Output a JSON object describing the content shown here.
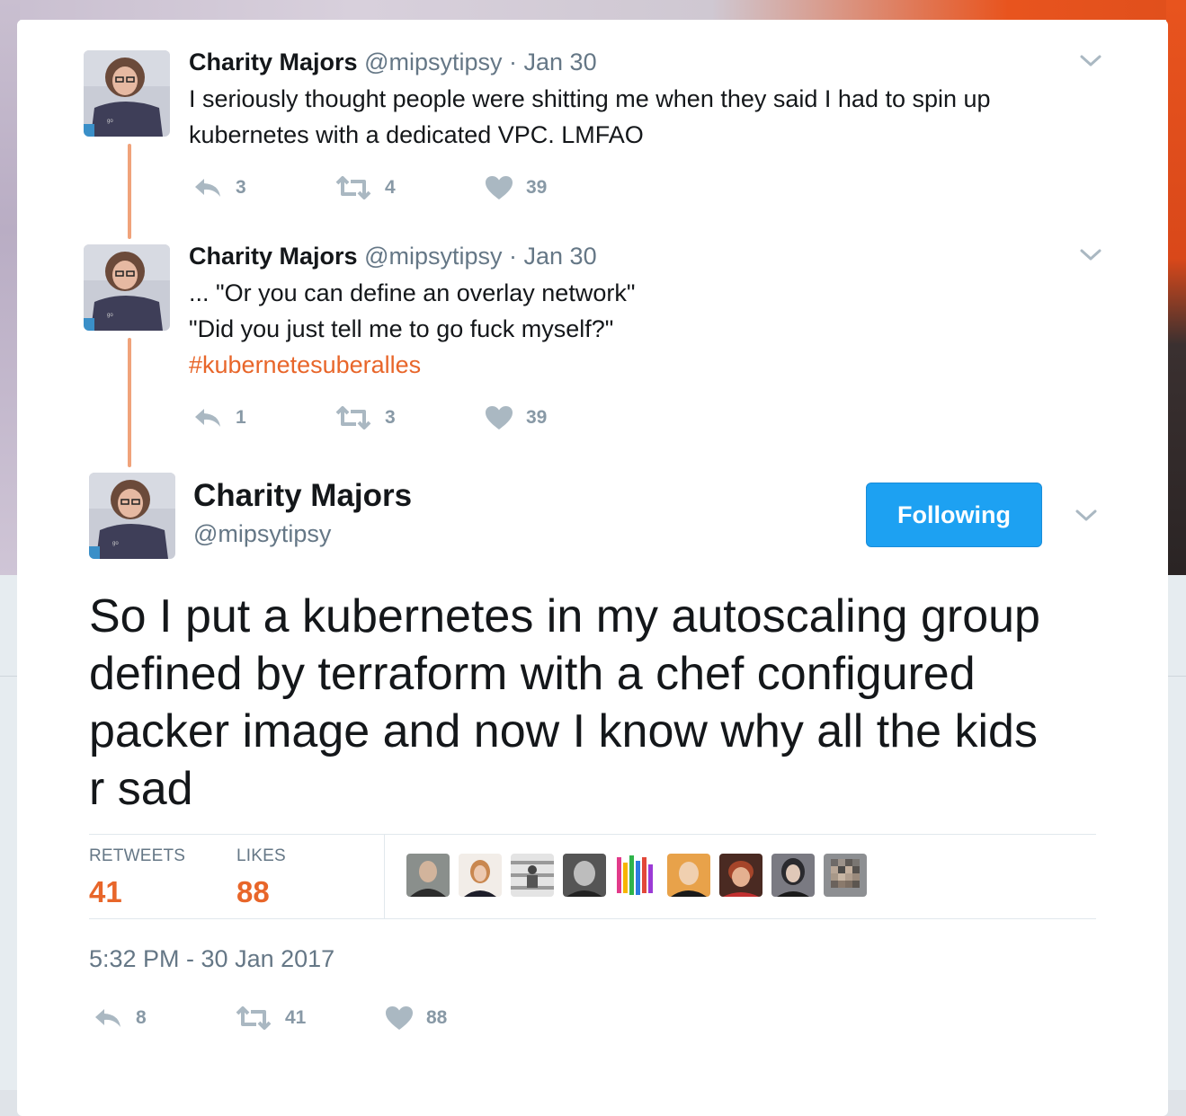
{
  "thread": [
    {
      "name": "Charity Majors",
      "handle": "@mipsytipsy",
      "date": "· Jan 30",
      "lines": [
        "I seriously thought people were shitting me when they said I had to spin up",
        "kubernetes with a dedicated VPC.  LMFAO"
      ],
      "replies": "3",
      "retweets": "4",
      "likes": "39"
    },
    {
      "name": "Charity Majors",
      "handle": "@mipsytipsy",
      "date": "· Jan 30",
      "lines": [
        "... \"Or you can define an overlay network\"",
        "\"Did you just tell me to go fuck myself?\""
      ],
      "hashtag": "#kubernetesuberalles",
      "replies": "1",
      "retweets": "3",
      "likes": "39"
    }
  ],
  "main": {
    "name": "Charity Majors",
    "handle": "@mipsytipsy",
    "follow_label": "Following",
    "text_lines": [
      "So I put a kubernetes in my autoscaling group",
      "defined by terraform with a chef configured",
      "packer image and now I know why all the kids",
      "r sad"
    ],
    "retweets_label": "RETWEETS",
    "retweets_count": "41",
    "likes_label": "LIKES",
    "likes_count": "88",
    "timestamp": "5:32 PM - 30 Jan 2017",
    "replies": "8",
    "retweets": "41",
    "likes": "88"
  },
  "colors": {
    "accent": "#e8662a",
    "follow_button": "#1da1f2",
    "thread_line": "#f0a37b",
    "action_gray": "#8899a6"
  },
  "icons": [
    "reply-icon",
    "retweet-icon",
    "heart-icon",
    "chevron-down-icon"
  ]
}
